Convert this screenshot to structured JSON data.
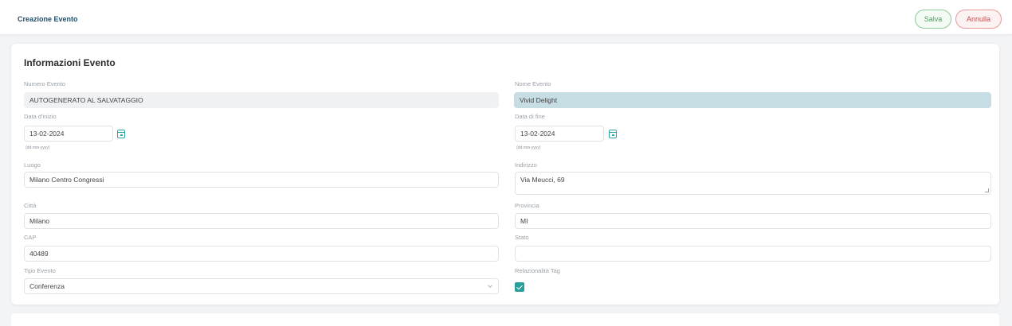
{
  "header": {
    "title": "Creazione Evento",
    "save_label": "Salva",
    "cancel_label": "Annulla"
  },
  "card": {
    "title": "Informazioni Evento"
  },
  "form": {
    "numero_evento": {
      "label": "Numero Evento",
      "value": "AUTOGENERATO AL SALVATAGGIO"
    },
    "nome_evento": {
      "label": "Nome Evento",
      "value": "Vivid Delight"
    },
    "data_inizio": {
      "label": "Data d'inizio",
      "value": "13-02-2024",
      "hint": "(dd-mm-yyyy)"
    },
    "data_fine": {
      "label": "Data di fine",
      "value": "13-02-2024",
      "hint": "(dd-mm-yyyy)"
    },
    "luogo": {
      "label": "Luogo",
      "value": "Milano Centro Congressi"
    },
    "indirizzo": {
      "label": "Indirizzo",
      "value": "Via Meucci, 69"
    },
    "citta": {
      "label": "Città",
      "value": "Milano"
    },
    "provincia": {
      "label": "Provincia",
      "value": "MI"
    },
    "cap": {
      "label": "CAP",
      "value": "40489"
    },
    "stato": {
      "label": "Stato",
      "value": ""
    },
    "tipo_evento": {
      "label": "Tipo Evento",
      "value": "Conferenza"
    },
    "relazionalita_tag": {
      "label": "Relazionalità Tag",
      "checked": true
    }
  },
  "colors": {
    "accent": "#2a9d9d",
    "save": "#4e9a5e",
    "cancel": "#c94b4b",
    "highlight_field": "#c6dde4"
  },
  "icons": {
    "calendar": "calendar-icon",
    "dropdown": "chevron-down-icon",
    "check": "check-icon"
  }
}
